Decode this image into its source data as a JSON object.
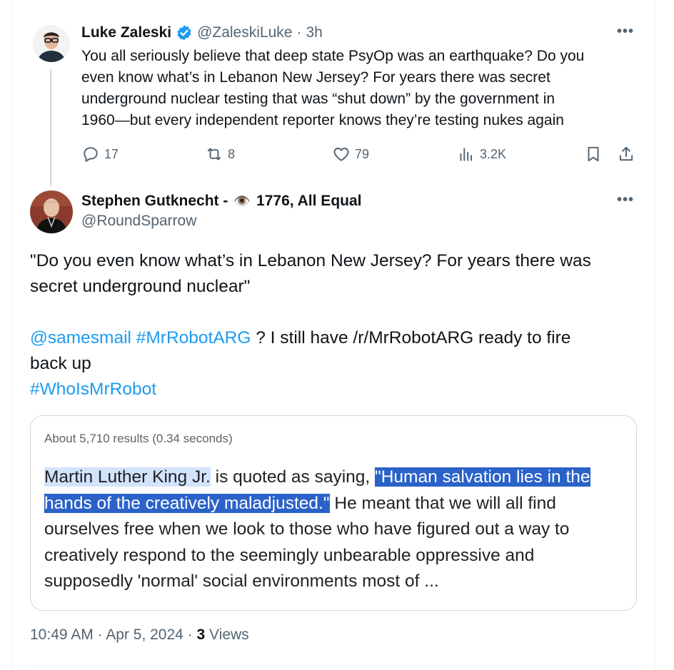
{
  "parent_tweet": {
    "display_name": "Luke Zaleski",
    "handle": "@ZaleskiLuke",
    "separator": "·",
    "time": "3h",
    "more": "•••",
    "text_lines": [
      "You all seriously believe that deep state PsyOp was an earthquake? Do you",
      "even know what’s in Lebanon New Jersey? For years there was secret",
      "underground nuclear testing that was “shut down” by the government in",
      "1960—but every independent reporter knows they’re testing nukes again"
    ],
    "actions": {
      "replies": "17",
      "reposts": "8",
      "likes": "79",
      "views": "3.2K"
    },
    "verified_color": "#1d9bf0"
  },
  "main_tweet": {
    "display_name_prefix": "Stephen Gutknecht -",
    "display_name_emoji": "👁️",
    "display_name_suffix": "1776, All Equal",
    "handle": "@RoundSparrow",
    "more": "•••",
    "quote_line_1": "\"Do you even know what’s in Lebanon New Jersey? For years there was",
    "quote_line_2": "secret underground nuclear\"",
    "mention": "@samesmail",
    "hashtag1": "#MrRobotARG",
    "line3_rest": "? I still have /r/MrRobotARG ready to fire",
    "line4": "back up",
    "hashtag2": "#WhoIsMrRobot",
    "card": {
      "results": "About 5,710 results (0.34 seconds)",
      "mlk": "Martin Luther King Jr.",
      "quoted_as": " is quoted as saying, ",
      "quote_part1": "\"Human salvation lies in the",
      "quote_part2": "hands of the creatively maladjusted.\"",
      "after_quote": " He meant that we will all find",
      "line3": "ourselves free when we look to those who have figured out a way to",
      "line4": "creatively respond to the seemingly unbearable oppressive and",
      "line5": "supposedly 'normal' social environments most of ..."
    },
    "footer": {
      "time": "10:49 AM",
      "dot1": " · ",
      "date": "Apr 5, 2024",
      "dot2": " · ",
      "views_count": "3",
      "views_label": "Views"
    },
    "link_color": "#1d9bf0"
  }
}
